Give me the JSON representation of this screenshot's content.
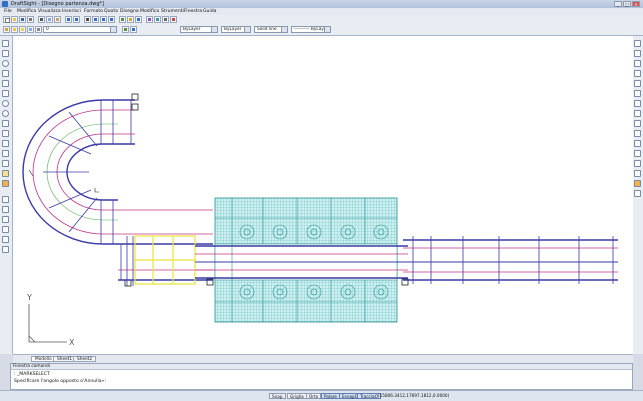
{
  "window": {
    "title": "DraftSight - [Disegno partenza.dwg*]",
    "controls": [
      "_",
      "□",
      "✕"
    ]
  },
  "menu": [
    "File",
    "Modifica",
    "Visualizza",
    "Inserisci",
    "Formato",
    "Quota",
    "Disegna",
    "Modifica",
    "Strumenti",
    "Finestra",
    "Guida"
  ],
  "toolbar2": {
    "layer_value": "0",
    "color_value": "ByLayer",
    "linetype_value": "ByLayer",
    "lineweight_value": "Solid line",
    "linestyle_value": "---------- ByLayer"
  },
  "tabs": [
    "Modello",
    "Sheet1",
    "Sheet2"
  ],
  "command": {
    "header": "Finestra comandi",
    "line1": ": _MARKSELECT",
    "line2": "Specificare l'angolo opposto o'Annulla»:"
  },
  "statusbar": {
    "buttons": [
      "Snap",
      "Griglia",
      "Orto",
      "Polare",
      "EsnapO",
      "TracciaO"
    ],
    "active": [
      "Polare",
      "EsnapO",
      "TracciaO"
    ],
    "coordinates": "(15806.3412,17697.1812,0.0000)"
  },
  "ucs": {
    "x_label": "X",
    "y_label": "Y"
  },
  "colors": {
    "conveyor_frame": "#3a3aa8",
    "rail_magenta": "#c0308a",
    "roller_green": "#4caf50",
    "selected_yellow": "#e8e43a",
    "hatch_cyan": "#3bb3b3",
    "hatch_fill": "#cdeff0"
  }
}
